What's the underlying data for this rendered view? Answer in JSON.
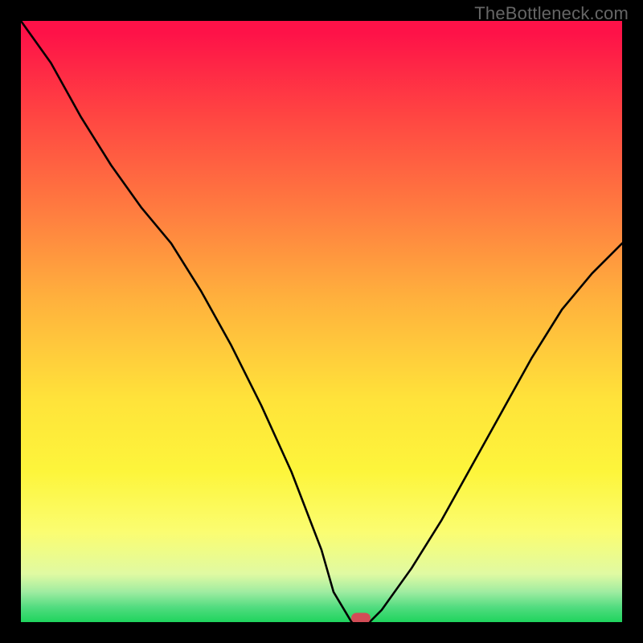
{
  "watermark": "TheBottleneck.com",
  "marker": {
    "x_pct": 56.5,
    "y_pct": 99.3
  },
  "chart_data": {
    "type": "line",
    "title": "",
    "xlabel": "",
    "ylabel": "",
    "xlim": [
      0,
      100
    ],
    "ylim": [
      0,
      100
    ],
    "legend": false,
    "grid": false,
    "background_gradient_stops": [
      {
        "pct": 0,
        "color": "#fe1248"
      },
      {
        "pct": 16,
        "color": "#ff4642"
      },
      {
        "pct": 31,
        "color": "#ff7a40"
      },
      {
        "pct": 46,
        "color": "#ffb03d"
      },
      {
        "pct": 63,
        "color": "#ffe33a"
      },
      {
        "pct": 75,
        "color": "#fdf53b"
      },
      {
        "pct": 85,
        "color": "#fbfd71"
      },
      {
        "pct": 92,
        "color": "#e0faa2"
      },
      {
        "pct": 95,
        "color": "#9feca1"
      },
      {
        "pct": 97.5,
        "color": "#52dc80"
      },
      {
        "pct": 100,
        "color": "#1fd45d"
      }
    ],
    "series": [
      {
        "name": "bottleneck-curve",
        "x": [
          0,
          5,
          10,
          15,
          20,
          25,
          30,
          35,
          40,
          45,
          50,
          52,
          55,
          58,
          60,
          65,
          70,
          75,
          80,
          85,
          90,
          95,
          100
        ],
        "y": [
          100,
          93,
          84,
          76,
          69,
          63,
          55,
          46,
          36,
          25,
          12,
          5,
          0,
          0,
          2,
          9,
          17,
          26,
          35,
          44,
          52,
          58,
          63
        ]
      }
    ],
    "marker": {
      "x": 56.5,
      "y": 0.7,
      "shape": "pill",
      "color": "#d24c56"
    }
  }
}
